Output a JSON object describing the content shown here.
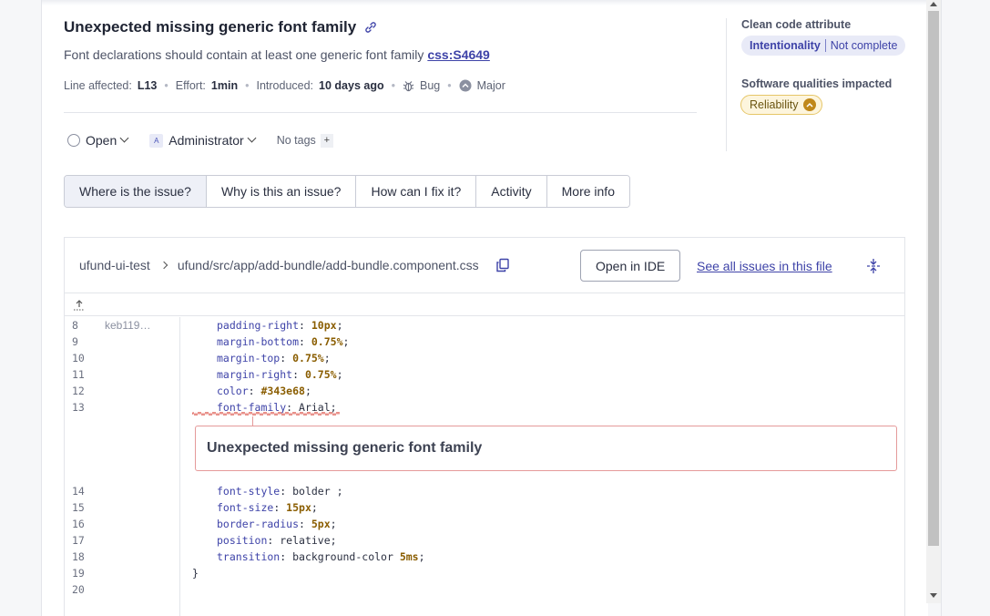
{
  "issue": {
    "title": "Unexpected missing generic font family",
    "rule_message": "Font declarations should contain at least one generic font family",
    "rule_key": "css:S4649",
    "meta": {
      "line_label": "Line affected:",
      "line_value": "L13",
      "effort_label": "Effort:",
      "effort_value": "1min",
      "introduced_label": "Introduced:",
      "introduced_value": "10 days ago",
      "type": "Bug",
      "severity": "Major"
    },
    "status": "Open",
    "assignee": "Administrator",
    "assignee_avatar": "A",
    "tags": "No tags",
    "tags_add": "+"
  },
  "side": {
    "clean_code_label": "Clean code attribute",
    "attribute_name": "Intentionality",
    "attribute_value": "Not complete",
    "qualities_label": "Software qualities impacted",
    "quality": "Reliability"
  },
  "tabs": [
    {
      "label": "Where is the issue?",
      "active": true
    },
    {
      "label": "Why is this an issue?",
      "active": false
    },
    {
      "label": "How can I fix it?",
      "active": false
    },
    {
      "label": "Activity",
      "active": false
    },
    {
      "label": "More info",
      "active": false
    }
  ],
  "code_viewer": {
    "project": "ufund-ui-test",
    "file_path": "ufund/src/app/add-bundle/add-bundle.component.css",
    "open_ide_label": "Open in IDE",
    "see_all_label": "See all issues in this file",
    "blame_author": "keb119…",
    "inline_issue": "Unexpected missing generic font family",
    "lines": [
      {
        "n": "8",
        "prop": "padding-right",
        "val": "10px",
        "num": true
      },
      {
        "n": "9",
        "prop": "margin-bottom",
        "val": "0.75%",
        "num": true
      },
      {
        "n": "10",
        "prop": "margin-top",
        "val": "0.75%",
        "num": true
      },
      {
        "n": "11",
        "prop": "margin-right",
        "val": "0.75%",
        "num": true
      },
      {
        "n": "12",
        "prop": "color",
        "val": "#343e68",
        "num": true
      },
      {
        "n": "13",
        "prop": "font-family",
        "val": "Arial",
        "num": false
      },
      {
        "n": "14",
        "prop": "font-style",
        "val": "bolder ",
        "num": false
      },
      {
        "n": "15",
        "prop": "font-size",
        "val": "15px",
        "num": true
      },
      {
        "n": "16",
        "prop": "border-radius",
        "val": "5px",
        "num": true
      },
      {
        "n": "17",
        "prop": "position",
        "val": "relative",
        "num": false
      },
      {
        "n": "18",
        "prop": "transition",
        "val": "background-color 5ms",
        "num": true
      }
    ],
    "closing_brace": "}",
    "line_19": "19",
    "line_20": "20"
  },
  "colors": {
    "accent": "#3e43a8",
    "issue_border": "#e59a9a",
    "reliability_bg": "#fdf5dd"
  }
}
